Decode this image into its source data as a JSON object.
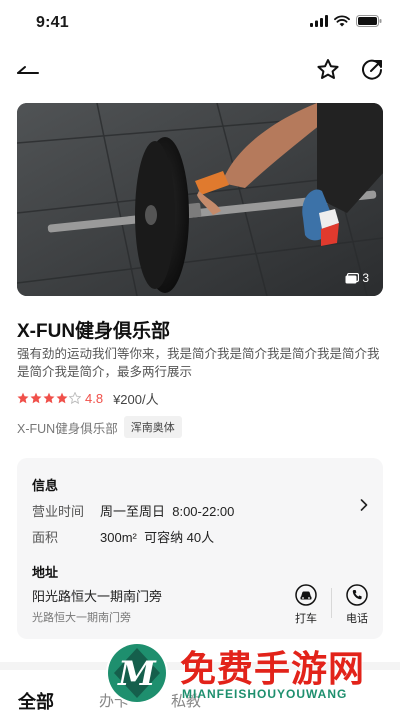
{
  "status_bar": {
    "time": "9:41"
  },
  "hero": {
    "photo_count": "3"
  },
  "venue": {
    "title": "X-FUN健身俱乐部",
    "description": "强有劲的运动我们等你来，我是简介我是简介我是简介我是简介我是简介我是简介，最多两行展示",
    "rating": "4.8",
    "rating_stars": 4.8,
    "price": "¥200/人",
    "club_name": "X-FUN健身俱乐部",
    "tag": "浑南奥体"
  },
  "info_card": {
    "info_heading": "信息",
    "hours_label": "营业时间",
    "hours_value": "周一至周日  8:00-22:00",
    "area_label": "面积",
    "area_value": "300m²  可容纳 40人",
    "address_heading": "地址",
    "address_line1": "阳光路恒大一期南门旁",
    "address_line2": "光路恒大一期南门旁",
    "taxi_label": "打车",
    "phone_label": "电话"
  },
  "tabs": [
    {
      "label": "全部",
      "active": true
    },
    {
      "label": "办卡",
      "active": false
    },
    {
      "label": "私教",
      "active": false
    }
  ],
  "watermark": {
    "title": "免费手游网",
    "subtitle": "MIANFEISHOUYOUWANG"
  },
  "colors": {
    "accent_red": "#f0504a",
    "watermark_red": "#e2231a",
    "watermark_green": "#1e8f6e"
  }
}
